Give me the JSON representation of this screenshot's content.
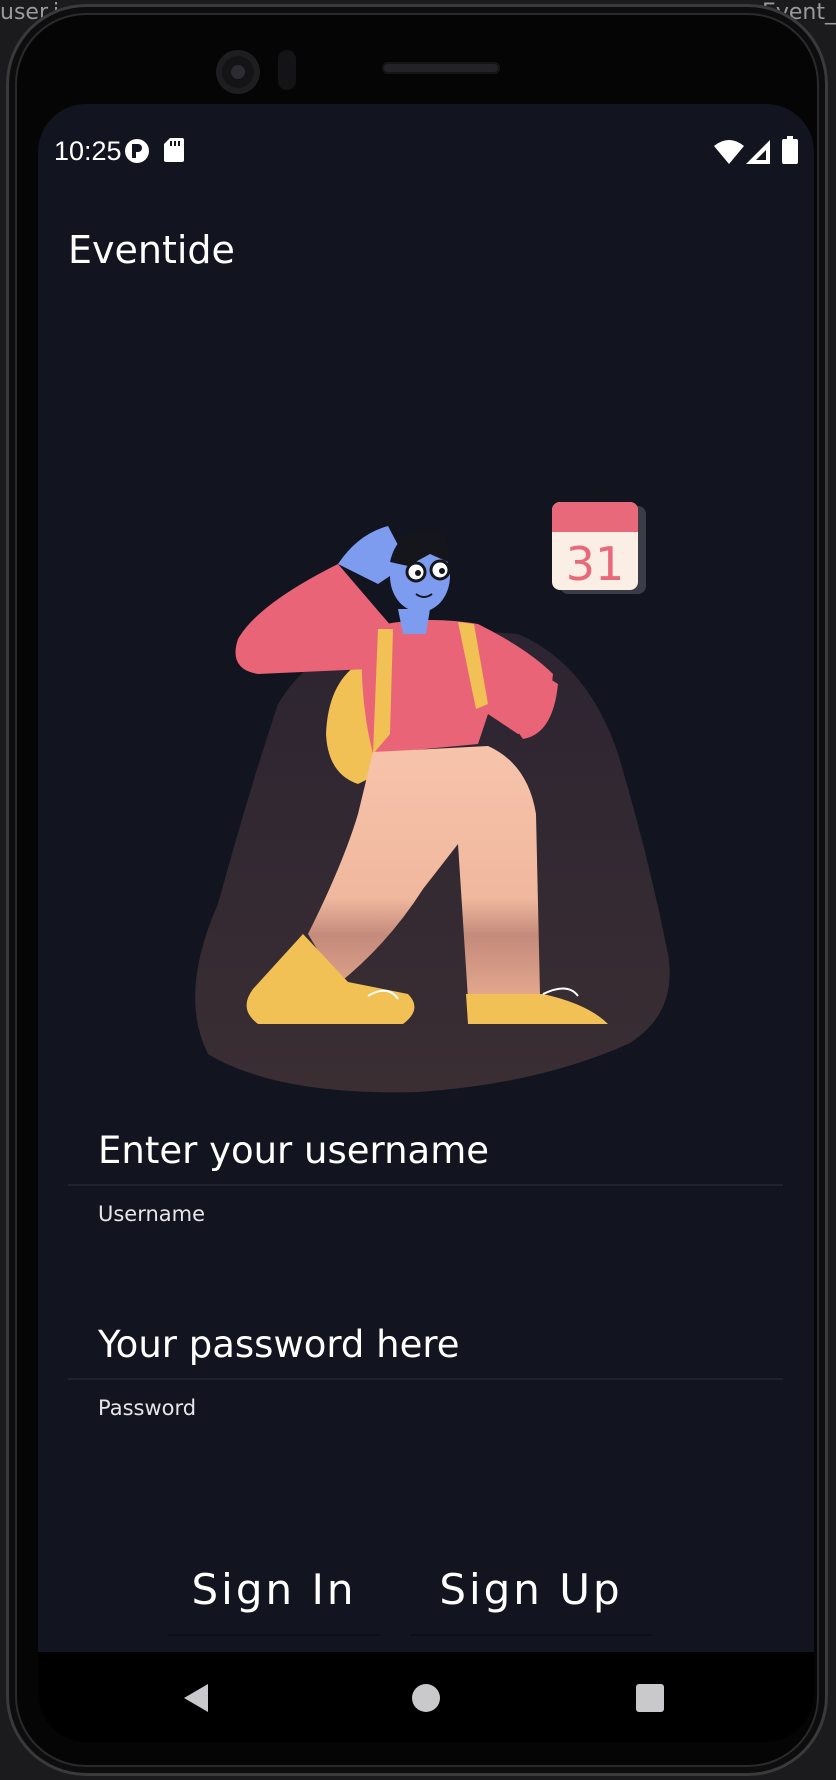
{
  "background_window": {
    "left_fragment": "user.i",
    "right_fragment": "Event_"
  },
  "status_bar": {
    "time": "10:25",
    "left_icons": [
      "app-notification-icon",
      "sd-card-icon"
    ],
    "right_icons": [
      "wifi-icon",
      "cell-signal-icon",
      "battery-icon"
    ]
  },
  "app": {
    "title": "Eventide"
  },
  "illustration": {
    "calendar_day": "31",
    "colors": {
      "calendar_red": "#e8697a",
      "shirt": "#ea6478",
      "pants": "#f6c2a8",
      "shoes": "#f1c155",
      "skin": "#7d9cf0"
    }
  },
  "login_form": {
    "username": {
      "placeholder": "Enter your username",
      "value": "",
      "label": "Username"
    },
    "password": {
      "placeholder": "Your password here",
      "value": "",
      "label": "Password"
    }
  },
  "actions": {
    "sign_in": "Sign In",
    "sign_up": "Sign Up"
  },
  "nav_bar": {
    "buttons": [
      "back-icon",
      "home-icon",
      "recents-icon"
    ]
  },
  "colors": {
    "screen_background": "#121420",
    "text": "#ffffff"
  }
}
